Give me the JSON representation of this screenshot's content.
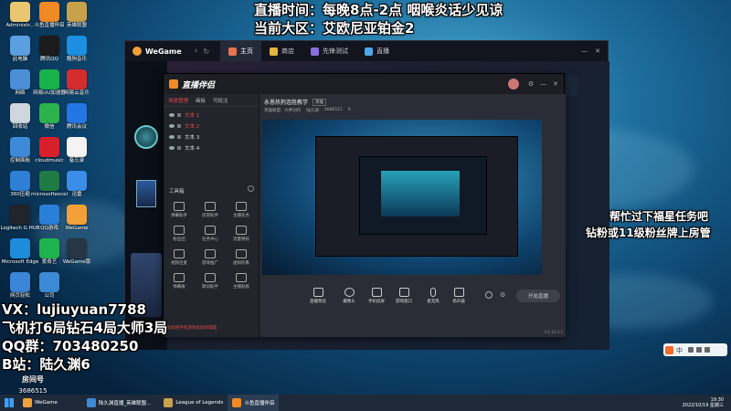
{
  "overlay": {
    "top_line1": "直播时间：每晚8点-2点   咽喉炎话少见谅",
    "top_line2": "当前大区：艾欧尼亚铂金2",
    "right_line1": "帮忙过下福星任务吧",
    "right_line2": "钻粉或11级粉丝牌上房管",
    "vx": "VX：lujiuyuan7788",
    "record": "飞机打6局钻石4局大师3局",
    "qq": "QQ群：703480250",
    "bili": "B站：陆久渊6",
    "room_label": "房间号",
    "room_id": "3686515"
  },
  "desktop": {
    "icons": [
      {
        "label": "Administr...",
        "color": "#e8c770"
      },
      {
        "label": "此电脑",
        "color": "#5aa0e0"
      },
      {
        "label": "网络",
        "color": "#4b8fd8"
      },
      {
        "label": "回收站",
        "color": "#cfd6de"
      },
      {
        "label": "控制面板",
        "color": "#3d8bd8"
      },
      {
        "label": "360压缩",
        "color": "#2e7fd6"
      },
      {
        "label": "Logitech G HUB",
        "color": "#20242b"
      },
      {
        "label": "Microsoft Edge",
        "color": "#1d8ddb"
      },
      {
        "label": "网页轻松",
        "color": "#3b86d8"
      },
      {
        "label": "斗鱼直播伴侣",
        "color": "#f08a24"
      },
      {
        "label": "腾讯QQ",
        "color": "#1b1b1b"
      },
      {
        "label": "网易UU加速器",
        "color": "#18b24b"
      },
      {
        "label": "微信",
        "color": "#2bb24c"
      },
      {
        "label": "cloudmusic",
        "color": "#d8202c"
      },
      {
        "label": "microsoftexcel",
        "color": "#1f7a44"
      },
      {
        "label": "QQ游戏",
        "color": "#2a7fd8"
      },
      {
        "label": "爱奇艺",
        "color": "#1fb54e"
      },
      {
        "label": "公司",
        "color": "#3c8ad6"
      },
      {
        "label": "英雄联盟",
        "color": "#c8a24a"
      },
      {
        "label": "酷狗音乐",
        "color": "#1c8fe0"
      },
      {
        "label": "网易云音乐",
        "color": "#d52d2d"
      },
      {
        "label": "腾讯会议",
        "color": "#2477e3"
      },
      {
        "label": "备忘录",
        "color": "#f3f3f3"
      },
      {
        "label": "迅雷",
        "color": "#3b8ee8"
      },
      {
        "label": "WeGame",
        "color": "#f2a037"
      },
      {
        "label": "WeGame版",
        "color": "#283544"
      }
    ]
  },
  "wegame": {
    "logo": "WeGame",
    "tabs": [
      "主页",
      "商店",
      "先锋测试",
      "直播"
    ],
    "back_icon": "back-arrow-icon",
    "refresh_icon": "refresh-icon"
  },
  "zhibo": {
    "logo": "直播伴侣",
    "left_tabs": [
      "场景管理",
      "画板",
      "可批注"
    ],
    "sources": [
      "文本 1",
      "文本 2",
      "文本 3",
      "文本 4"
    ],
    "toolbox_title": "工具箱",
    "tools": [
      "弹幕助手",
      "房管助手",
      "主播任务",
      "粉丝团",
      "任务中心",
      "流量特权",
      "视频连麦",
      "游戏推广",
      "虚拟形象",
      "弹幕板",
      "歌词助手",
      "主播贴纸"
    ],
    "room_title": "永恩热狗连胜教学",
    "room_tag": "英雄",
    "room_meta": [
      "英雄联盟 · 大神创作",
      "陆久渊",
      "3686515",
      "0"
    ],
    "bottom_buttons": [
      "直播预览",
      "摄像头",
      "手机投屏",
      "游戏窗口",
      "麦克风",
      "扬声器"
    ],
    "start_button": "开始直播",
    "version": "V3.10.13",
    "notice": "如何把手机游戏投屏到电脑"
  },
  "ime": {
    "label": "中"
  },
  "taskbar": {
    "items": [
      "WeGame",
      "陆久渊直播_英雄联盟...",
      "League of Legends",
      "斗鱼直播伴侣"
    ],
    "time": "19:30",
    "date": "2022/10/19 星期三"
  }
}
